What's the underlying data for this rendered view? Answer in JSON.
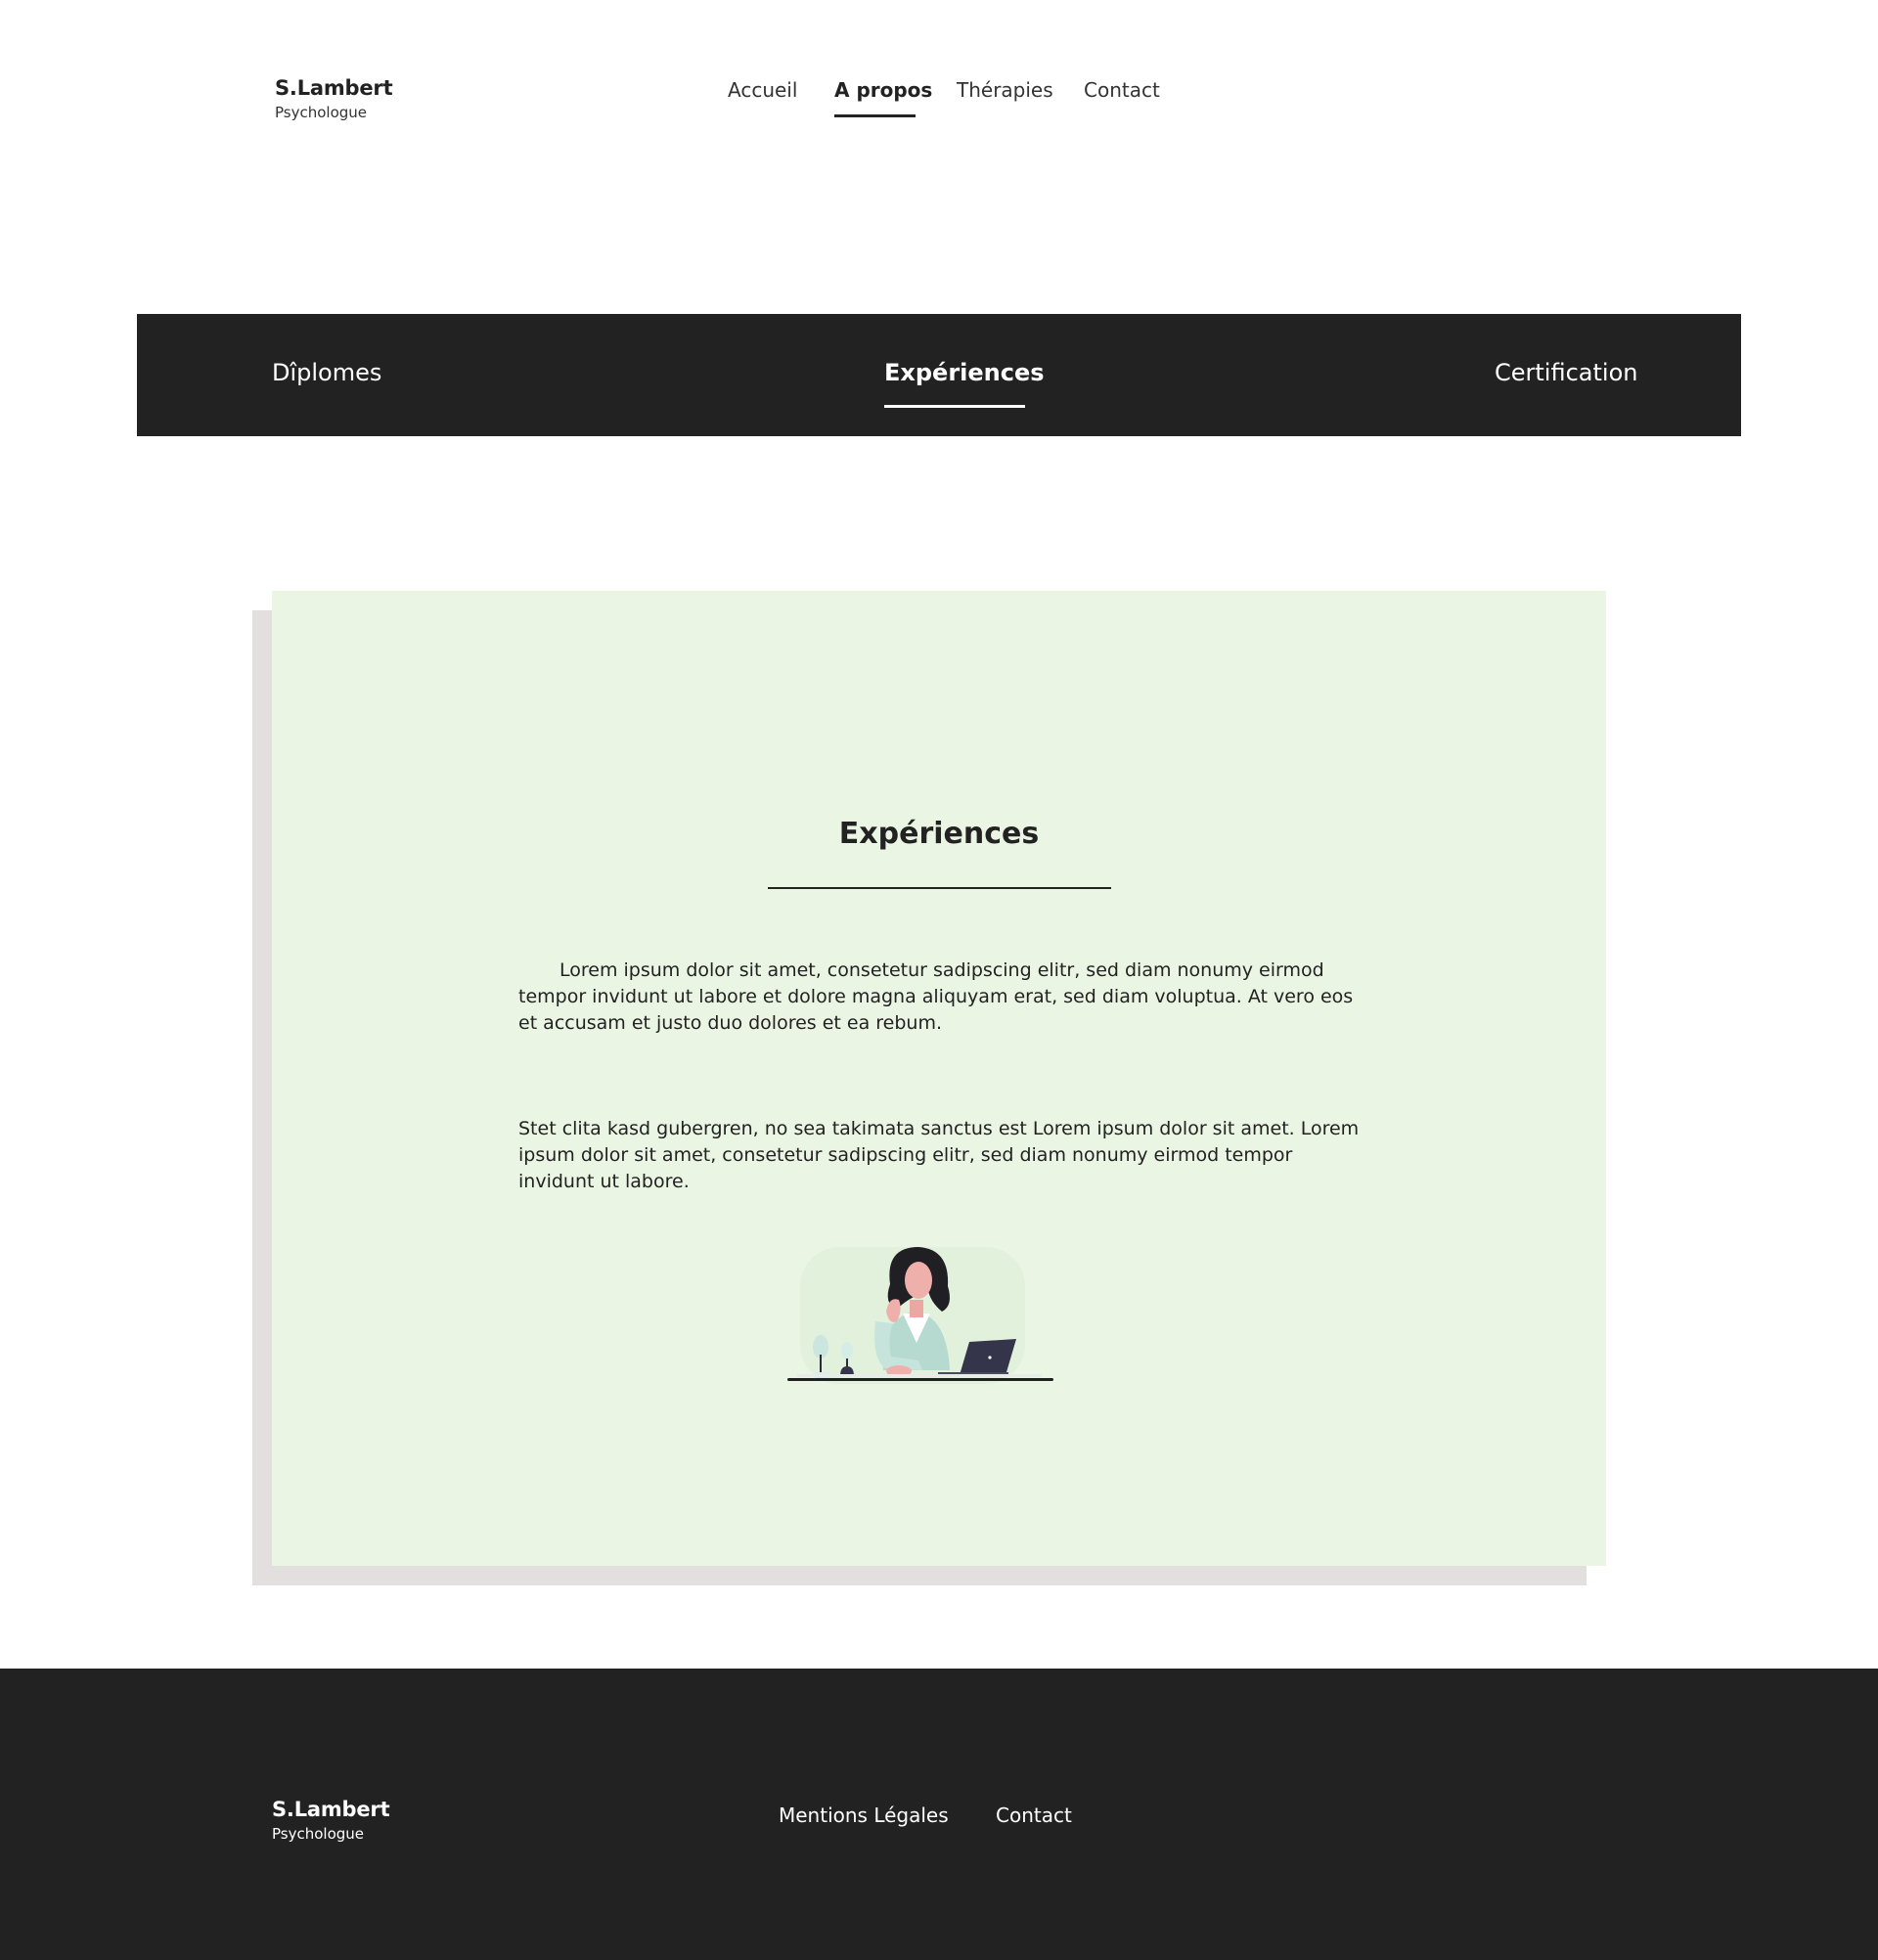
{
  "brand": {
    "name": "S.Lambert",
    "subtitle": "Psychologue"
  },
  "nav": {
    "items": [
      {
        "label": "Accueil"
      },
      {
        "label": "A propos"
      },
      {
        "label": "Thérapies"
      },
      {
        "label": "Contact"
      }
    ],
    "active_index": 1
  },
  "tabs": {
    "items": [
      {
        "label": "Dîplomes"
      },
      {
        "label": "Expériences"
      },
      {
        "label": "Certification"
      }
    ],
    "active_index": 1
  },
  "section": {
    "title": "Expériences",
    "paragraphs": [
      "Lorem ipsum dolor sit amet, consetetur sadipscing elitr, sed diam nonumy eirmod tempor invidunt ut labore et dolore magna aliquyam erat, sed diam voluptua. At vero eos et accusam et justo duo dolores et ea rebum.",
      "Stet clita kasd gubergren, no sea takimata sanctus est Lorem ipsum dolor sit amet. Lorem ipsum dolor sit amet, consetetur sadipscing elitr, sed diam nonumy eirmod tempor invidunt ut labore."
    ],
    "illustration_icon": "woman-at-laptop-illustration"
  },
  "footer": {
    "brand": {
      "name": "S.Lambert",
      "subtitle": "Psychologue"
    },
    "links": [
      {
        "label": "Mentions Légales"
      },
      {
        "label": "Contact"
      }
    ]
  },
  "colors": {
    "dark": "#222222",
    "card_bg": "#ebf5e4",
    "card_shadow": "#e3dfdf",
    "page_bg": "#ffffff"
  }
}
